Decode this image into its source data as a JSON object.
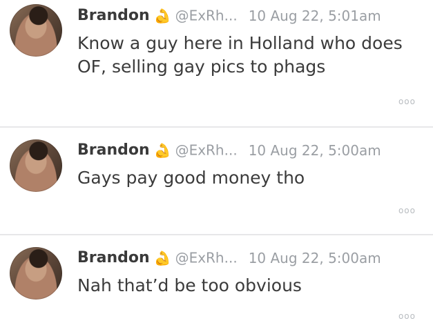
{
  "tweets": [
    {
      "name": "Brandon",
      "badge_icon": "flexed-biceps-icon",
      "handle": "@ExRh...",
      "time": "10 Aug 22, 5:01am",
      "text": "Know a guy here in Holland who does OF, selling gay pics to phags",
      "more": "ooo"
    },
    {
      "name": "Brandon",
      "badge_icon": "flexed-biceps-icon",
      "handle": "@ExRh...",
      "time": "10 Aug 22, 5:00am",
      "text": "Gays pay good money tho",
      "more": "ooo"
    },
    {
      "name": "Brandon",
      "badge_icon": "flexed-biceps-icon",
      "handle": "@ExRh...",
      "time": "10 Aug 22, 5:00am",
      "text": "Nah that’d be too obvious",
      "more": "ooo"
    }
  ]
}
